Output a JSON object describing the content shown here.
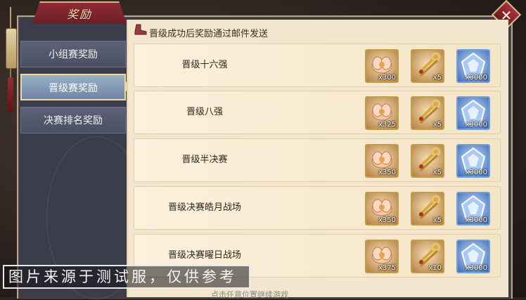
{
  "window": {
    "title": "奖励"
  },
  "close_icon": "close-icon",
  "sidebar": {
    "tabs": [
      {
        "label": "小组赛奖励",
        "active": false
      },
      {
        "label": "晋级赛奖励",
        "active": true
      },
      {
        "label": "决赛排名奖励",
        "active": false
      }
    ]
  },
  "panel": {
    "notice": "晋级成功后奖励通过邮件发送",
    "notice_icon": "boot-icon",
    "rows": [
      {
        "label": "晋级十六强",
        "items": [
          {
            "icon": "lotus-flower-icon",
            "count": "x300"
          },
          {
            "icon": "golden-keys-icon",
            "count": "x5"
          },
          {
            "icon": "blue-crystal-icon",
            "count": "x3000"
          }
        ]
      },
      {
        "label": "晋级八强",
        "items": [
          {
            "icon": "lotus-flower-icon",
            "count": "x325"
          },
          {
            "icon": "golden-keys-icon",
            "count": "x5"
          },
          {
            "icon": "blue-crystal-icon",
            "count": "x3000"
          }
        ]
      },
      {
        "label": "晋级半决赛",
        "items": [
          {
            "icon": "lotus-flower-icon",
            "count": "x350"
          },
          {
            "icon": "golden-keys-icon",
            "count": "x5"
          },
          {
            "icon": "blue-crystal-icon",
            "count": "x3000"
          }
        ]
      },
      {
        "label": "晋级决赛皓月战场",
        "items": [
          {
            "icon": "lotus-flower-icon",
            "count": "x350"
          },
          {
            "icon": "golden-keys-icon",
            "count": "x5"
          },
          {
            "icon": "blue-crystal-icon",
            "count": "x3000"
          }
        ]
      },
      {
        "label": "晋级决赛曜日战场",
        "items": [
          {
            "icon": "lotus-flower-icon",
            "count": "x375"
          },
          {
            "icon": "golden-keys-icon",
            "count": "x10"
          },
          {
            "icon": "blue-crystal-icon",
            "count": "x3000"
          }
        ]
      }
    ]
  },
  "watermark": "图片来源于测试服，仅供参考",
  "bottom_hint": "点击任意位置继续游戏",
  "colors": {
    "accent": "#8f2c34",
    "gold_frame": "#c79a44",
    "blue_frame": "#6ea0e0",
    "panel_bg": "#f3e6ce"
  }
}
